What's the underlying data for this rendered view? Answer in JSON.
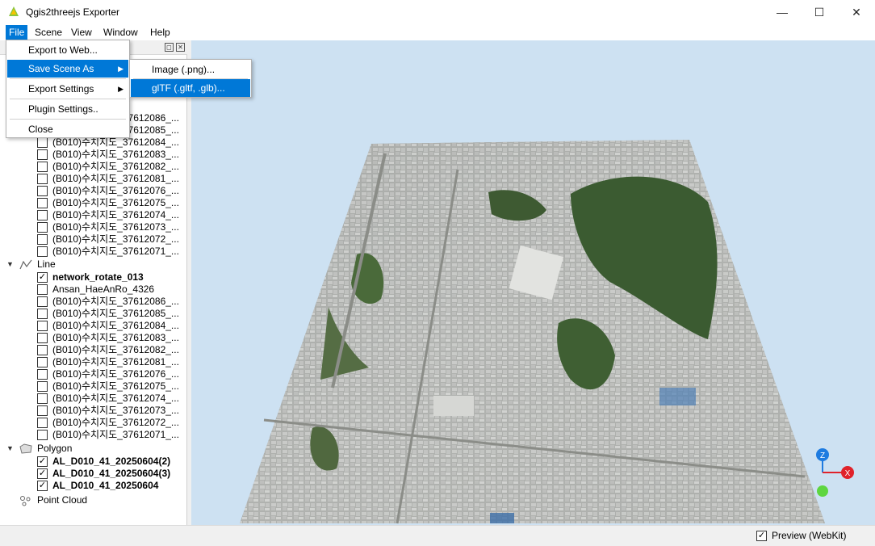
{
  "window": {
    "title": "Qgis2threejs Exporter",
    "minimize": "—",
    "maximize": "☐",
    "close": "✕"
  },
  "menubar": {
    "file": "File",
    "scene": "Scene",
    "view": "View",
    "window": "Window",
    "help": "Help"
  },
  "file_menu": {
    "export_web": "Export to Web...",
    "save_scene_as": "Save Scene As",
    "export_settings": "Export Settings",
    "plugin_settings": "Plugin Settings..",
    "close": "Close"
  },
  "save_submenu": {
    "image": "Image (.png)...",
    "gltf": "glTF (.gltf, .glb)..."
  },
  "layers": {
    "group_dem_rows": [
      {
        "label": "(B010)수치지도_37612086_...",
        "checked": false
      },
      {
        "label": "(B010)수치지도_37612085_...",
        "checked": false
      },
      {
        "label": "(B010)수치지도_37612084_...",
        "checked": false
      },
      {
        "label": "(B010)수치지도_37612083_...",
        "checked": false
      },
      {
        "label": "(B010)수치지도_37612082_...",
        "checked": false
      },
      {
        "label": "(B010)수치지도_37612081_...",
        "checked": false
      },
      {
        "label": "(B010)수치지도_37612076_...",
        "checked": false
      },
      {
        "label": "(B010)수치지도_37612075_...",
        "checked": false
      },
      {
        "label": "(B010)수치지도_37612074_...",
        "checked": false
      },
      {
        "label": "(B010)수치지도_37612073_...",
        "checked": false
      },
      {
        "label": "(B010)수치지도_37612072_...",
        "checked": false
      },
      {
        "label": "(B010)수치지도_37612071_...",
        "checked": false
      }
    ],
    "line_group": "Line",
    "line_rows": [
      {
        "label": "network_rotate_013",
        "checked": true
      },
      {
        "label": "Ansan_HaeAnRo_4326",
        "checked": false
      },
      {
        "label": "(B010)수치지도_37612086_...",
        "checked": false
      },
      {
        "label": "(B010)수치지도_37612085_...",
        "checked": false
      },
      {
        "label": "(B010)수치지도_37612084_...",
        "checked": false
      },
      {
        "label": "(B010)수치지도_37612083_...",
        "checked": false
      },
      {
        "label": "(B010)수치지도_37612082_...",
        "checked": false
      },
      {
        "label": "(B010)수치지도_37612081_...",
        "checked": false
      },
      {
        "label": "(B010)수치지도_37612076_...",
        "checked": false
      },
      {
        "label": "(B010)수치지도_37612075_...",
        "checked": false
      },
      {
        "label": "(B010)수치지도_37612074_...",
        "checked": false
      },
      {
        "label": "(B010)수치지도_37612073_...",
        "checked": false
      },
      {
        "label": "(B010)수치지도_37612072_...",
        "checked": false
      },
      {
        "label": "(B010)수치지도_37612071_...",
        "checked": false
      }
    ],
    "polygon_group": "Polygon",
    "polygon_rows": [
      {
        "label": "AL_D010_41_20250604(2)",
        "checked": true
      },
      {
        "label": "AL_D010_41_20250604(3)",
        "checked": true
      },
      {
        "label": "AL_D010_41_20250604",
        "checked": true
      }
    ],
    "point_cloud": "Point Cloud"
  },
  "status": {
    "preview_label": "Preview (WebKit)",
    "preview_checked": true
  },
  "colors": {
    "accent": "#0078d7",
    "sky": "#cde1f2",
    "axis_x": "#e0222a",
    "axis_y": "#2ecc40",
    "axis_z": "#1e7be0"
  },
  "axis_labels": {
    "x": "X",
    "z": "Z"
  }
}
